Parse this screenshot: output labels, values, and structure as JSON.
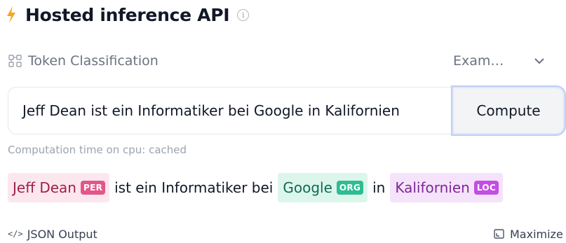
{
  "header": {
    "title": "Hosted inference API",
    "bolt_color": "#f5a623",
    "info_icon": "info-icon"
  },
  "task": {
    "icon": "token-classification-icon",
    "label": "Token Classification"
  },
  "examples": {
    "label": "Exam…",
    "icon": "chevron-down-icon"
  },
  "input": {
    "value": "Jeff Dean ist ein Informatiker bei Google in Kalifornien"
  },
  "compute_button": {
    "label": "Compute"
  },
  "computation_time": "Computation time on cpu: cached",
  "result": {
    "segments": [
      {
        "text": "Jeff Dean",
        "entity": "PER",
        "color": "#e2578a"
      },
      {
        "text": "ist ein Informatiker bei"
      },
      {
        "text": "Google",
        "entity": "ORG",
        "color": "#2fbc93"
      },
      {
        "text": "in"
      },
      {
        "text": "Kalifornien",
        "entity": "LOC",
        "color": "#c24ee2"
      }
    ]
  },
  "footer": {
    "json_icon": "</>",
    "json_label": "JSON Output",
    "maximize_label": "Maximize",
    "maximize_icon": "maximize-icon"
  }
}
